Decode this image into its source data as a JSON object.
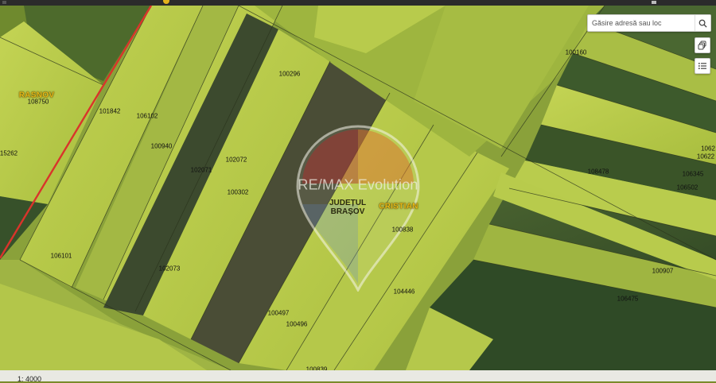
{
  "search": {
    "placeholder": "Găsire adresă sau loc"
  },
  "footer": {
    "scale": "1: 4000"
  },
  "watermark": {
    "text": "RE/MAX Evolution"
  },
  "localities": [
    {
      "name": "RASNOV"
    },
    {
      "name": "CRISTIAN"
    }
  ],
  "county": {
    "line1": "JUDEȚUL",
    "line2": "BRAȘOV"
  },
  "parcels": [
    "108750",
    "101842",
    "106102",
    "100296",
    "100940",
    "102071",
    "102072",
    "100302",
    "100160",
    "15262",
    "106101",
    "102073",
    "100838",
    "108478",
    "106345",
    "106502",
    "1062",
    "10622",
    "100907",
    "104446",
    "106475",
    "100497",
    "100496",
    "100839"
  ],
  "icons": {
    "search": "search-icon",
    "layers": "layers-icon",
    "legend": "legend-list-icon"
  },
  "colors": {
    "boundary_red": "#d9342b",
    "locality_yellow": "#e8b917",
    "field_light": "#b7c94a",
    "field_dark": "#3f5a2c"
  }
}
